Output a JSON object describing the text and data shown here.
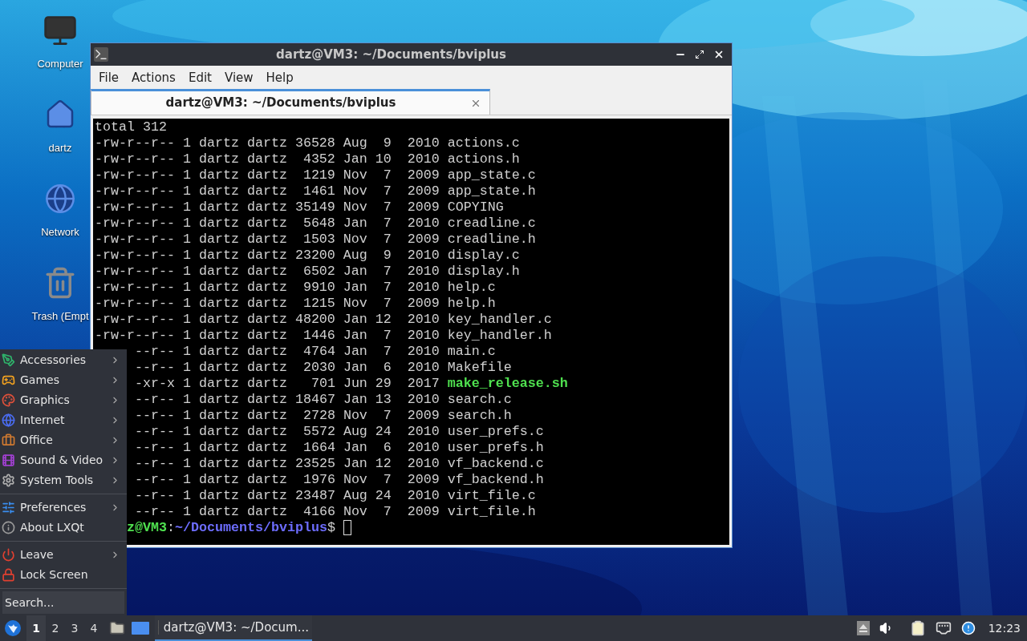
{
  "desktop_icons": [
    {
      "label": "Computer"
    },
    {
      "label": "dartz"
    },
    {
      "label": "Network"
    },
    {
      "label": "Trash (Empt"
    }
  ],
  "window": {
    "title": "dartz@VM3: ~/Documents/bviplus",
    "menu": [
      "File",
      "Actions",
      "Edit",
      "View",
      "Help"
    ],
    "tabs": [
      {
        "label": "dartz@VM3: ~/Documents/bviplus",
        "selected": true
      }
    ],
    "terminal": {
      "header": "total 312",
      "rows": [
        {
          "text": "-rw-r--r-- 1 dartz dartz 36528 Aug  9  2010 ",
          "name": "actions.c",
          "kind": "file"
        },
        {
          "text": "-rw-r--r-- 1 dartz dartz  4352 Jan 10  2010 ",
          "name": "actions.h",
          "kind": "file"
        },
        {
          "text": "-rw-r--r-- 1 dartz dartz  1219 Nov  7  2009 ",
          "name": "app_state.c",
          "kind": "file"
        },
        {
          "text": "-rw-r--r-- 1 dartz dartz  1461 Nov  7  2009 ",
          "name": "app_state.h",
          "kind": "file"
        },
        {
          "text": "-rw-r--r-- 1 dartz dartz 35149 Nov  7  2009 ",
          "name": "COPYING",
          "kind": "file"
        },
        {
          "text": "-rw-r--r-- 1 dartz dartz  5648 Jan  7  2010 ",
          "name": "creadline.c",
          "kind": "file"
        },
        {
          "text": "-rw-r--r-- 1 dartz dartz  1503 Nov  7  2009 ",
          "name": "creadline.h",
          "kind": "file"
        },
        {
          "text": "-rw-r--r-- 1 dartz dartz 23200 Aug  9  2010 ",
          "name": "display.c",
          "kind": "file"
        },
        {
          "text": "-rw-r--r-- 1 dartz dartz  6502 Jan  7  2010 ",
          "name": "display.h",
          "kind": "file"
        },
        {
          "text": "-rw-r--r-- 1 dartz dartz  9910 Jan  7  2010 ",
          "name": "help.c",
          "kind": "file"
        },
        {
          "text": "-rw-r--r-- 1 dartz dartz  1215 Nov  7  2009 ",
          "name": "help.h",
          "kind": "file"
        },
        {
          "text": "-rw-r--r-- 1 dartz dartz 48200 Jan 12  2010 ",
          "name": "key_handler.c",
          "kind": "file"
        },
        {
          "text": "-rw-r--r-- 1 dartz dartz  1446 Jan  7  2010 ",
          "name": "key_handler.h",
          "kind": "file"
        }
      ],
      "rows_behind_menu": [
        {
          "text": "--r-- 1 dartz dartz  4764 Jan  7  2010 ",
          "name": "main.c",
          "kind": "file"
        },
        {
          "text": "--r-- 1 dartz dartz  2030 Jan  6  2010 ",
          "name": "Makefile",
          "kind": "file"
        },
        {
          "text": "-xr-x 1 dartz dartz   701 Jun 29  2017 ",
          "name": "make_release.sh",
          "kind": "exec"
        },
        {
          "text": "--r-- 1 dartz dartz 18467 Jan 13  2010 ",
          "name": "search.c",
          "kind": "file"
        },
        {
          "text": "--r-- 1 dartz dartz  2728 Nov  7  2009 ",
          "name": "search.h",
          "kind": "file"
        },
        {
          "text": "--r-- 1 dartz dartz  5572 Aug 24  2010 ",
          "name": "user_prefs.c",
          "kind": "file"
        },
        {
          "text": "--r-- 1 dartz dartz  1664 Jan  6  2010 ",
          "name": "user_prefs.h",
          "kind": "file"
        },
        {
          "text": "--r-- 1 dartz dartz 23525 Jan 12  2010 ",
          "name": "vf_backend.c",
          "kind": "file"
        },
        {
          "text": "--r-- 1 dartz dartz  1976 Nov  7  2009 ",
          "name": "vf_backend.h",
          "kind": "file"
        },
        {
          "text": "--r-- 1 dartz dartz 23487 Aug 24  2010 ",
          "name": "virt_file.c",
          "kind": "file"
        },
        {
          "text": "--r-- 1 dartz dartz  4166 Nov  7  2009 ",
          "name": "virt_file.h",
          "kind": "file"
        }
      ],
      "prompt": {
        "user_host": "z@VM3",
        "separator": ":",
        "path": "~/Documents/bviplus",
        "sign": "$"
      }
    }
  },
  "start_menu": {
    "sections": [
      [
        {
          "label": "Accessories",
          "submenu": true
        },
        {
          "label": "Games",
          "submenu": true
        },
        {
          "label": "Graphics",
          "submenu": true
        },
        {
          "label": "Internet",
          "submenu": true
        },
        {
          "label": "Office",
          "submenu": true
        },
        {
          "label": "Sound & Video",
          "submenu": true
        },
        {
          "label": "System Tools",
          "submenu": true
        }
      ],
      [
        {
          "label": "Preferences",
          "submenu": true
        },
        {
          "label": "About LXQt",
          "submenu": false
        }
      ],
      [
        {
          "label": "Leave",
          "submenu": true
        },
        {
          "label": "Lock Screen",
          "submenu": false
        }
      ]
    ],
    "search": {
      "placeholder": "Search..."
    }
  },
  "taskbar": {
    "desktops": [
      {
        "label": "1",
        "selected": true
      },
      {
        "label": "2",
        "selected": false
      },
      {
        "label": "3",
        "selected": false
      },
      {
        "label": "4",
        "selected": false
      }
    ],
    "tasks": [
      {
        "label": "dartz@VM3: ~/Docum...",
        "selected": true
      }
    ],
    "clock": "12:23"
  }
}
